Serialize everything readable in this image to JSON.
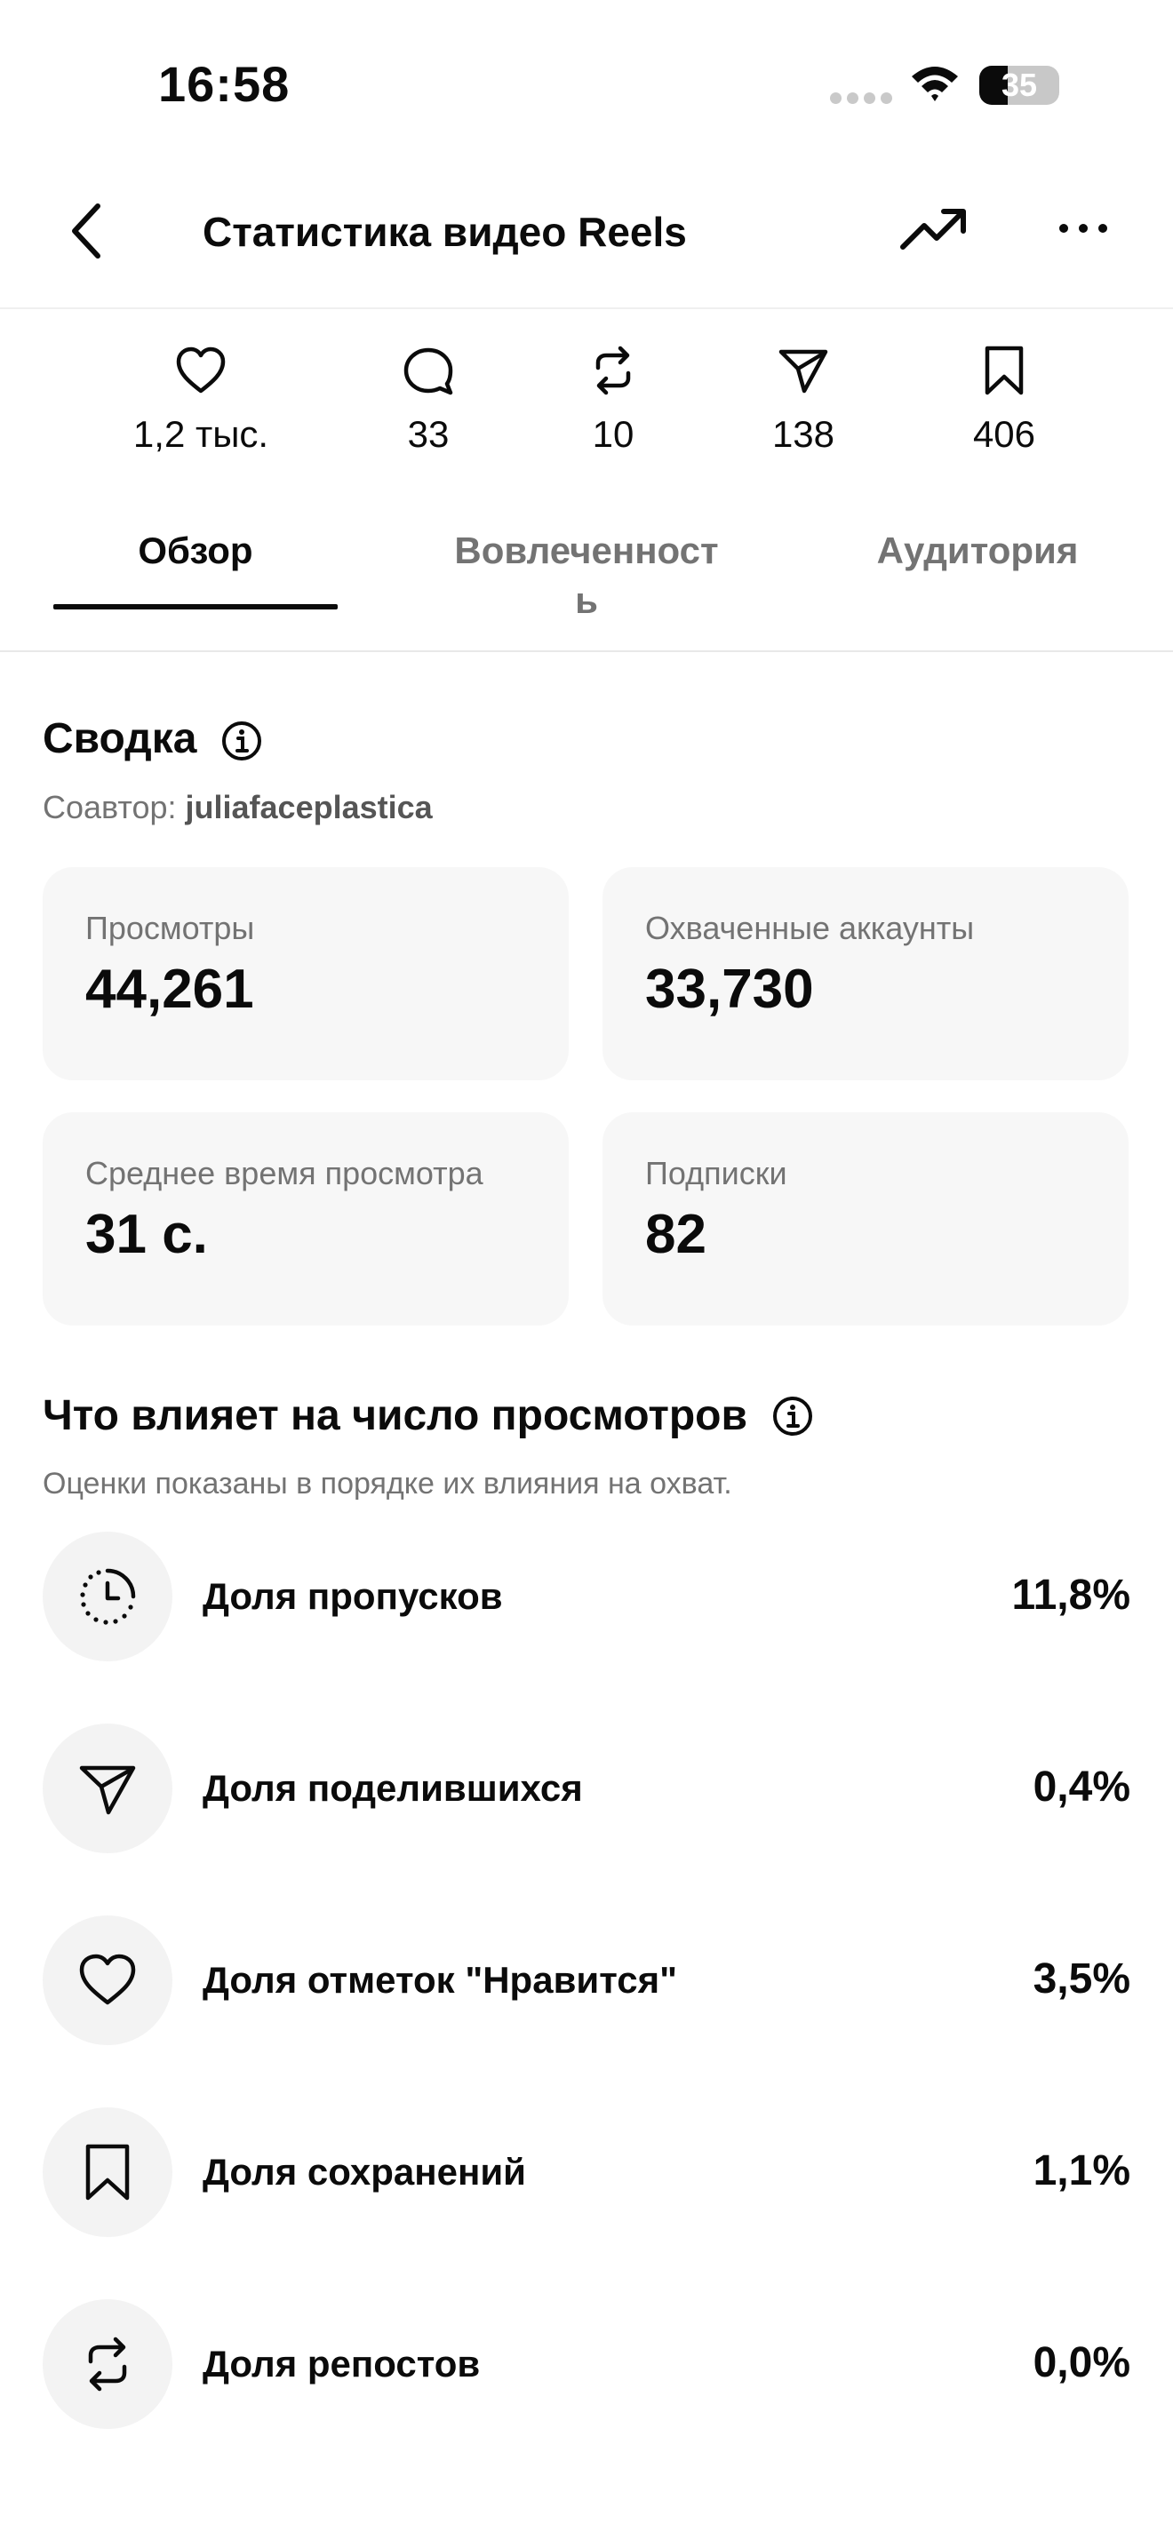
{
  "status_bar": {
    "time": "16:58",
    "battery": "35",
    "battery_level_percent": 35
  },
  "header": {
    "title": "Статистика видео Reels",
    "back_icon": "chevron-left-icon",
    "trend_icon": "trending-up-icon",
    "more_icon": "more-horizontal-icon"
  },
  "counts": {
    "likes": "1,2 тыс.",
    "comments": "33",
    "reposts": "10",
    "shares": "138",
    "saves": "406"
  },
  "tabs": [
    {
      "label": "Обзор",
      "active": true
    },
    {
      "label": "Вовлеченност",
      "label_wrap": "ь",
      "active": false
    },
    {
      "label": "Аудитория",
      "active": false
    }
  ],
  "summary": {
    "title": "Сводка",
    "coauthor_prefix": "Соавтор: ",
    "coauthor_name": "juliafaceplastica",
    "cards": [
      {
        "label": "Просмотры",
        "value": "44,261"
      },
      {
        "label": "Охваченные аккаунты",
        "value": "33,730"
      },
      {
        "label": "Среднее время просмотра",
        "value": "31 с."
      },
      {
        "label": "Подписки",
        "value": "82"
      }
    ]
  },
  "factors": {
    "title": "Что влияет на число просмотров",
    "subtitle": "Оценки показаны в порядке их влияния на охват.",
    "items": [
      {
        "icon": "timer-icon",
        "label": "Доля пропусков",
        "value": "11,8%"
      },
      {
        "icon": "send-icon",
        "label": "Доля поделившихся",
        "value": "0,4%"
      },
      {
        "icon": "heart-icon",
        "label": "Доля отметок \"Нравится\"",
        "value": "3,5%"
      },
      {
        "icon": "bookmark-icon",
        "label": "Доля сохранений",
        "value": "1,1%"
      },
      {
        "icon": "repost-icon",
        "label": "Доля репостов",
        "value": "0,0%"
      }
    ]
  },
  "colors": {
    "text": "#0b0b0b",
    "secondary": "#737373",
    "card_bg": "#f7f7f7",
    "icon_bg": "#f3f3f3"
  }
}
